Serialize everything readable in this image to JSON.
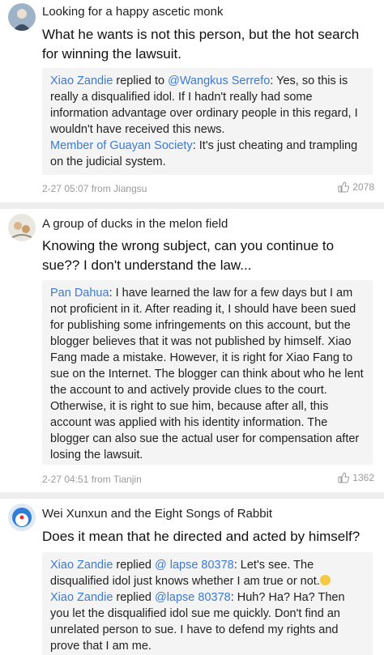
{
  "posts": [
    {
      "username": "Looking for a happy ascetic monk",
      "content": "What he wants is not this person, but the hot search for winning the lawsuit.",
      "replies": [
        {
          "name": "Xiao Zandie",
          "connector": " replied to ",
          "target": "@Wangkus Serrefo",
          "text": ": Yes, so this is really a disqualified idol. If I hadn't really had some information advantage over ordinary people in this regard, I wouldn't have received this news."
        },
        {
          "name": "Member of Guayan Society",
          "text": ": It's just cheating and trampling on the judicial system."
        }
      ],
      "meta": "2-27 05:07 from Jiangsu",
      "likes": "2078"
    },
    {
      "username": "A group of ducks in the melon field",
      "content": "Knowing the wrong subject, can you continue to sue?? I don't understand the law...",
      "replies": [
        {
          "name": "Pan Dahua",
          "text": ": I have learned the law for a few days but I am not proficient in it. After reading it, I should have been sued for publishing some infringements on this account, but the blogger believes that it was not published by himself. Xiao Fang made a mistake. However, it is right for Xiao Fang to sue on the Internet. The blogger can think about who he lent the account to and actively provide clues to the court. Otherwise, it is right to sue him, because after all, this account was applied with his identity information. The blogger can also sue the actual user for compensation after losing the lawsuit."
        }
      ],
      "meta": "2-27 04:51 from Tianjin",
      "likes": "1362"
    },
    {
      "username": "Wei Xunxun and the Eight Songs of Rabbit",
      "content": "Does it mean that he directed and acted by himself?",
      "replies": [
        {
          "name": "Xiao Zandie",
          "connector": " replied ",
          "target": "@ lapse 80378",
          "text": ": Let's see. The disqualified idol just knows whether I am true or not."
        },
        {
          "name": "Xiao Zandie",
          "connector": " replied ",
          "target": "@lapse 80378",
          "text": ": Huh? Ha? Ha? Then you let the disqualified idol sue me quickly. Don't find an unrelated person to sue. I have to defend my rights and prove that I am me."
        }
      ]
    }
  ]
}
